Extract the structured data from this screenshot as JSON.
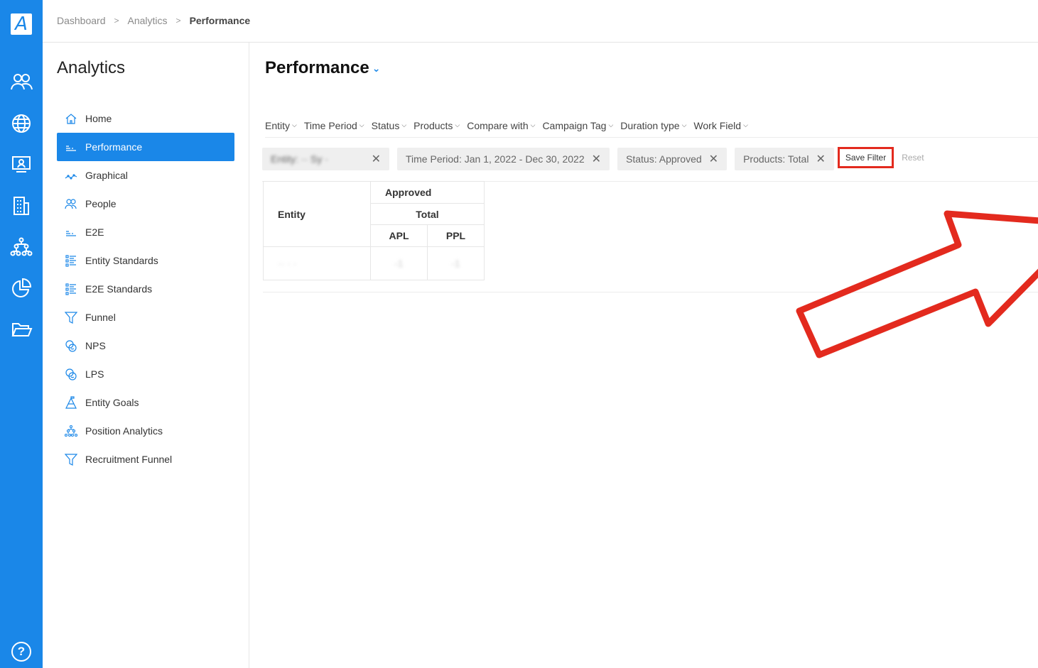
{
  "app": {
    "logo_letter": "A"
  },
  "rail": {
    "icons": [
      "people-icon",
      "globe-icon",
      "presentation-icon",
      "building-icon",
      "org-chart-icon",
      "pie-chart-icon",
      "folder-icon"
    ],
    "help_label": "?"
  },
  "breadcrumb": [
    "Dashboard",
    "Analytics",
    "Performance"
  ],
  "sidenav": {
    "title": "Analytics",
    "items": [
      {
        "label": "Home",
        "icon": "home-icon",
        "active": false
      },
      {
        "label": "Performance",
        "icon": "bars-icon",
        "active": true
      },
      {
        "label": "Graphical",
        "icon": "line-graph-icon",
        "active": false
      },
      {
        "label": "People",
        "icon": "people-icon",
        "active": false
      },
      {
        "label": "E2E",
        "icon": "bars-icon",
        "active": false
      },
      {
        "label": "Entity Standards",
        "icon": "checklist-icon",
        "active": false
      },
      {
        "label": "E2E Standards",
        "icon": "checklist-icon",
        "active": false
      },
      {
        "label": "Funnel",
        "icon": "funnel-icon",
        "active": false
      },
      {
        "label": "NPS",
        "icon": "smiley-icon",
        "active": false
      },
      {
        "label": "LPS",
        "icon": "smiley-icon",
        "active": false
      },
      {
        "label": "Entity Goals",
        "icon": "goal-icon",
        "active": false
      },
      {
        "label": "Position Analytics",
        "icon": "org-chart-icon",
        "active": false
      },
      {
        "label": "Recruitment Funnel",
        "icon": "funnel-icon",
        "active": false
      }
    ]
  },
  "main": {
    "title": "Performance",
    "filters": [
      "Entity",
      "Time Period",
      "Status",
      "Products",
      "Compare with",
      "Campaign Tag",
      "Duration type",
      "Work Field"
    ],
    "chips": [
      {
        "label": "Entity: ·· Sy ·",
        "blurred": true
      },
      {
        "label": "Time Period: Jan 1, 2022 - Dec 30, 2022",
        "blurred": false
      },
      {
        "label": "Status: Approved",
        "blurred": false
      },
      {
        "label": "Products: Total",
        "blurred": false
      }
    ],
    "save_filter_label": "Save Filter",
    "reset_label": "Reset",
    "table": {
      "entity_header": "Entity",
      "group_header": "Approved",
      "subgroup_header": "Total",
      "columns": [
        "APL",
        "PPL"
      ],
      "rows": [
        {
          "entity": "·· · ·",
          "values": [
            "-1",
            "-1"
          ]
        }
      ]
    }
  },
  "colors": {
    "brand": "#1a87e8",
    "highlight": "#e32a1e"
  }
}
